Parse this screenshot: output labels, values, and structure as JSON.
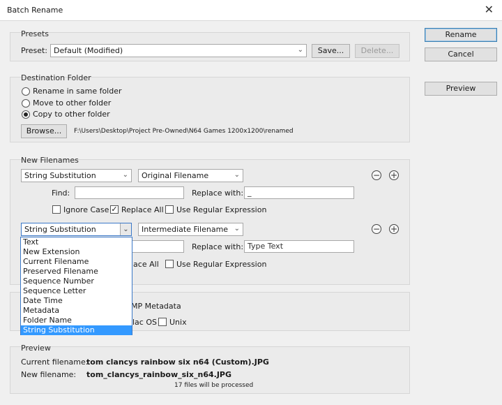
{
  "window": {
    "title": "Batch Rename",
    "close_glyph": "✕"
  },
  "actions": {
    "rename": "Rename",
    "cancel": "Cancel",
    "preview": "Preview"
  },
  "presets": {
    "title": "Presets",
    "label": "Preset:",
    "value": "Default (Modified)",
    "save": "Save...",
    "delete": "Delete..."
  },
  "destination": {
    "title": "Destination Folder",
    "options": [
      "Rename in same folder",
      "Move to other folder",
      "Copy to other folder"
    ],
    "selected_index": 2,
    "browse": "Browse...",
    "path": "F:\\Users\\Desktop\\Project Pre-Owned\\N64 Games 1200x1200\\renamed"
  },
  "new_filenames": {
    "title": "New Filenames",
    "rule1": {
      "type": "String Substitution",
      "source": "Original Filename",
      "find_label": "Find:",
      "find_value": "",
      "replace_label": "Replace with:",
      "replace_value": "_",
      "ignore_case": "Ignore Case",
      "ignore_case_checked": false,
      "replace_all": "Replace All",
      "replace_all_checked": true,
      "regex": "Use Regular Expression",
      "regex_checked": false
    },
    "rule2": {
      "type": "String Substitution",
      "source": "Intermediate Filename",
      "replace_label": "Replace with:",
      "replace_placeholder": "Type Text",
      "replace_all_partial": "lace All",
      "regex": "Use Regular Expression"
    },
    "minus_glyph": "−",
    "plus_glyph": "+",
    "dropdown_options": [
      "Text",
      "New Extension",
      "Current Filename",
      "Preserved Filename",
      "Sequence Number",
      "Sequence Letter",
      "Date Time",
      "Metadata",
      "Folder Name",
      "String Substitution"
    ],
    "dropdown_selected_index": 9
  },
  "options_partial": {
    "xmp": "MP Metadata",
    "mac": "lac OS",
    "unix": "Unix"
  },
  "preview": {
    "title": "Preview",
    "current_label": "Current filename:",
    "current_value": "tom clancys rainbow six n64 (Custom).JPG",
    "new_label": "New filename:",
    "new_value": "tom_clancys_rainbow_six_n64.JPG",
    "count": "17 files will be processed"
  }
}
